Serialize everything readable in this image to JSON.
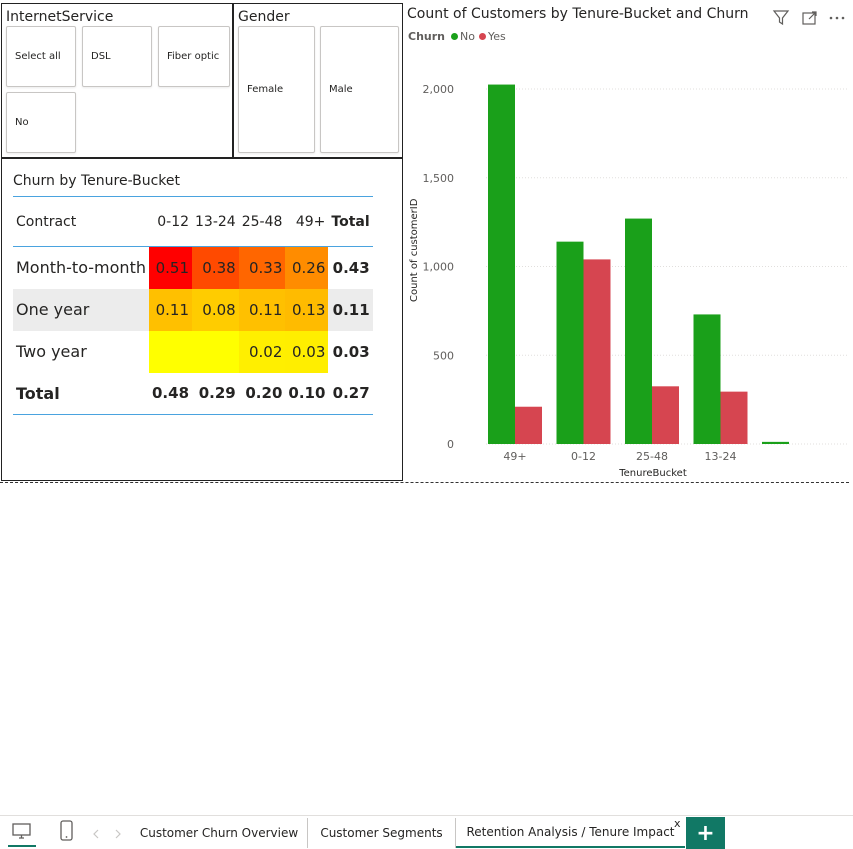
{
  "slicers": {
    "internet_service": {
      "title": "InternetService",
      "options": [
        "Select all",
        "DSL",
        "Fiber optic",
        "No"
      ]
    },
    "gender": {
      "title": "Gender",
      "options": [
        "Female",
        "Male"
      ]
    }
  },
  "matrix": {
    "title": "Churn by Tenure-Bucket",
    "row_header": "Contract",
    "columns": [
      "0-12",
      "13-24",
      "25-48",
      "49+",
      "Total"
    ],
    "rows": [
      {
        "label": "Month-to-month",
        "values": [
          "0.51",
          "0.38",
          "0.33",
          "0.26",
          "0.43"
        ]
      },
      {
        "label": "One year",
        "values": [
          "0.11",
          "0.08",
          "0.11",
          "0.13",
          "0.11"
        ]
      },
      {
        "label": "Two year",
        "values": [
          "",
          "",
          "0.02",
          "0.03",
          "0.03"
        ]
      }
    ],
    "total": {
      "label": "Total",
      "values": [
        "0.48",
        "0.29",
        "0.20",
        "0.10",
        "0.27"
      ]
    },
    "cell_colors": [
      [
        "#ff0000",
        "#ff4a00",
        "#ff6600",
        "#ff8c00"
      ],
      [
        "#ffc000",
        "#ffcc00",
        "#ffc000",
        "#ffbb00"
      ],
      [
        "#ffff00",
        "#ffff00",
        "#ffef00",
        "#ffee00"
      ]
    ]
  },
  "chart_data": {
    "type": "bar",
    "title": "Count of Customers by Tenure-Bucket and Churn",
    "legend_title": "Churn",
    "xlabel": "TenureBucket",
    "ylabel": "Count of customerID",
    "categories": [
      "49+",
      "0-12",
      "25-48",
      "13-24",
      ""
    ],
    "series": [
      {
        "name": "No",
        "color": "#1aa01a",
        "values": [
          2025,
          1140,
          1270,
          730,
          12
        ]
      },
      {
        "name": "Yes",
        "color": "#d64550",
        "values": [
          210,
          1040,
          325,
          295,
          0
        ]
      }
    ],
    "ylim": [
      0,
      2000
    ],
    "y_ticks": [
      "0",
      "500",
      "1,000",
      "1,500",
      "2,000"
    ],
    "grid": true,
    "legend_position": "top-left"
  },
  "icons": [
    "filter-icon",
    "focus-mode-icon",
    "more-options-icon",
    "desktop-view-icon",
    "mobile-view-icon",
    "prev-page-icon",
    "next-page-icon"
  ],
  "tabs": [
    {
      "label": "Customer Churn Overview",
      "active": false
    },
    {
      "label": "Customer Segments",
      "active": false
    },
    {
      "label": "Retention Analysis / Tenure Impact",
      "active": true
    }
  ],
  "tab_close_label": "x",
  "add_page_label": "+",
  "accent_color": "#117865"
}
